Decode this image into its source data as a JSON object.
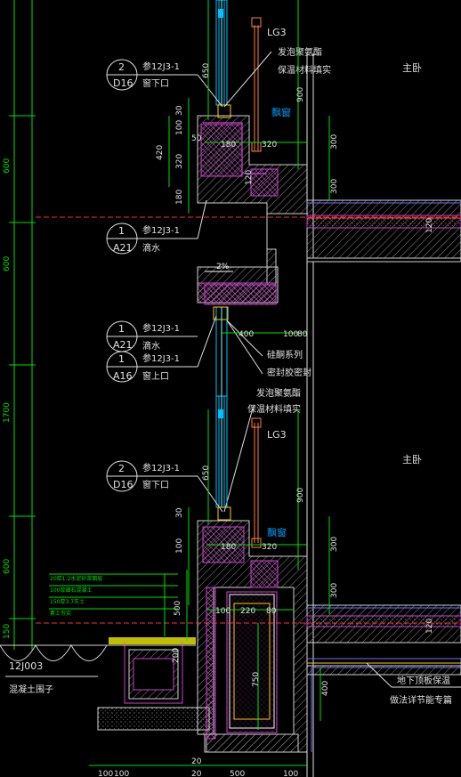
{
  "rooms": {
    "master_upper": "主卧",
    "master_lower": "主卧"
  },
  "callouts": {
    "c1": {
      "num": "2",
      "sheet": "D16",
      "ref": "参12J3-1",
      "desc": "窗下口"
    },
    "c2": {
      "num": "1",
      "sheet": "A21",
      "ref": "参12J3-1",
      "desc": "滴水"
    },
    "c3": {
      "num": "1",
      "sheet": "A21",
      "ref": "参12J3-1",
      "desc": "滴水"
    },
    "c4": {
      "num": "1",
      "sheet": "A16",
      "ref": "参12J3-1",
      "desc": "窗上口"
    },
    "c5": {
      "num": "2",
      "sheet": "D16",
      "ref": "参12J3-1",
      "desc": "窗下口"
    }
  },
  "notes": {
    "foam_fill_1": "发泡聚氨酯",
    "foam_fill_2": "保温材料填实",
    "lg3": "LG3",
    "bay_window": "飘窗",
    "slope": "2%",
    "silicone_1": "硅酮系列",
    "silicone_2": "密封胶密封",
    "basement_1": "地下顶板保温",
    "basement_2": "做法详节能专篇",
    "ref_12j003": "12J003",
    "concrete_plinth": "混凝土围子"
  },
  "layers": [
    "20厚1:2水泥砂浆面层",
    "100厚细石混凝土",
    "150厚3:7灰土",
    "素土夯实"
  ],
  "dims": {
    "d650a": "650",
    "d30a": "30",
    "d100a": "100",
    "d50a": "50",
    "d180a": "180",
    "d320a": "320",
    "d420": "420",
    "d320b": "320",
    "d180b": "180",
    "d120a": "120",
    "d300a": "300",
    "d300b": "300",
    "d900a": "900",
    "d400a": "400",
    "d100b": "100",
    "d80a": "80",
    "d650b": "650",
    "d30b": "30",
    "d100c": "100",
    "d180c": "180",
    "d320c": "320",
    "d900b": "900",
    "d300c": "300",
    "d300d": "300",
    "d500": "500",
    "d200": "200",
    "d100d": "100",
    "d220": "220",
    "d80b": "80",
    "d750": "750",
    "d400b": "400",
    "d120b": "120",
    "d120c": "120",
    "bot1": "100",
    "bot2": "100",
    "bot3": "20",
    "bot4": "500",
    "bot5": "100",
    "bot6": "20",
    "left_600a": "600",
    "left_600b": "600",
    "left_1700": "1700",
    "left_600c": "600",
    "left_150": "150"
  }
}
